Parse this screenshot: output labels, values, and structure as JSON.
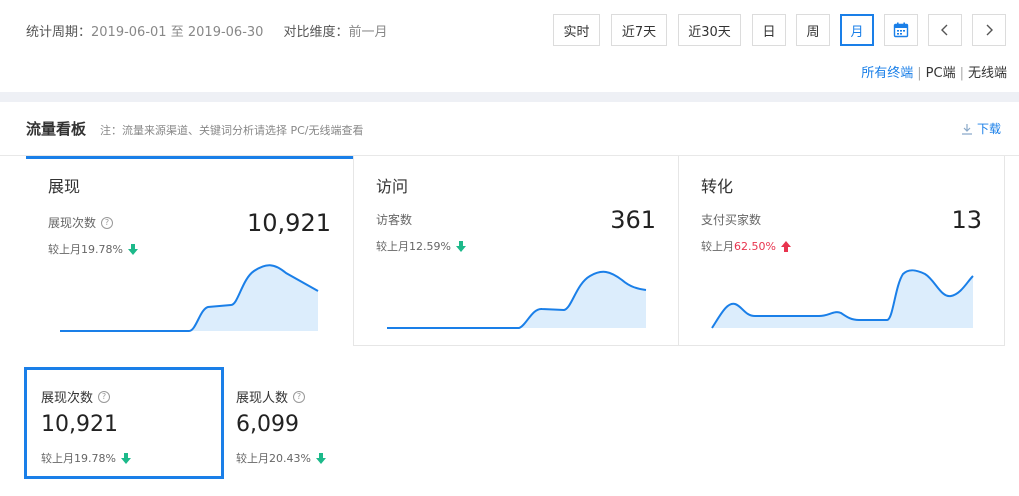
{
  "filters": {
    "period_label": "统计周期：",
    "period_start": "2019-06-01",
    "period_to": "至",
    "period_end": "2019-06-30",
    "compare_label": "对比维度：",
    "compare_value": "前一月",
    "buttons": [
      "实时",
      "近7天",
      "近30天",
      "日",
      "周",
      "月"
    ],
    "active_button": "月",
    "calendar_icon": "calendar-icon",
    "prev_icon": "chevron-left-icon",
    "next_icon": "chevron-right-icon"
  },
  "terminals": {
    "items": [
      "所有终端",
      "PC端",
      "无线端"
    ],
    "selected": "所有终端",
    "separator": "|"
  },
  "board": {
    "title": "流量看板",
    "note": "注：流量来源渠道、关键词分析请选择 PC/无线端查看",
    "download_label": "下载",
    "download_icon": "download-icon"
  },
  "cards": [
    {
      "title": "展现",
      "metric": "展现次数",
      "value": "10,921",
      "trend_label": "较上月",
      "trend_value": "19.78%",
      "direction": "down"
    },
    {
      "title": "访问",
      "metric": "访客数",
      "value": "361",
      "trend_label": "较上月",
      "trend_value": "12.59%",
      "direction": "down"
    },
    {
      "title": "转化",
      "metric": "支付买家数",
      "value": "13",
      "trend_label": "较上月",
      "trend_value": "62.50%",
      "direction": "up"
    }
  ],
  "tiles": [
    {
      "label": "展现次数",
      "value": "10,921",
      "trend_label": "较上月",
      "trend_value": "19.78%",
      "direction": "down"
    },
    {
      "label": "展现人数",
      "value": "6,099",
      "trend_label": "较上月",
      "trend_value": "20.43%",
      "direction": "down"
    }
  ],
  "colors": {
    "accent": "#1a7fe8",
    "down": "#1cb98a",
    "up": "#e8344e",
    "area_fill": "#dcedfc"
  }
}
